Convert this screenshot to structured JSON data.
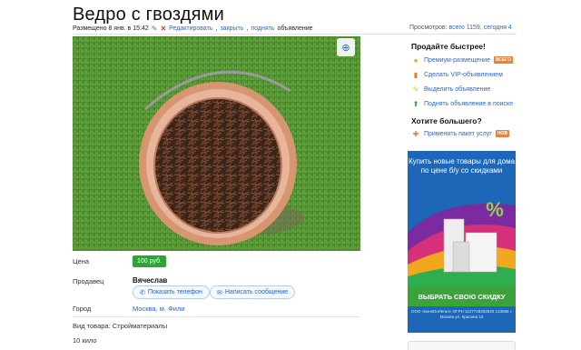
{
  "listing": {
    "title": "Ведро с гвоздями",
    "posted": "Размещено 8 янв. в 15:42",
    "actions": [
      "Редактировать",
      "закрыть",
      "поднять"
    ],
    "actions_suffix": "объявление",
    "views_label": "Просмотров:",
    "views_total": "всего 1159",
    "views_today": "сегодня 4"
  },
  "details": {
    "price_label": "Цена",
    "price": "100 руб.",
    "seller_label": "Продавец",
    "seller_name": "Вячеслав",
    "show_phone": "Показать телефон",
    "write_message": "Написать сообщение",
    "city_label": "Город",
    "city": "Москва, м. Фили",
    "type_line": "Вид товара: Стройматериалы",
    "description": "10 кило"
  },
  "sidebar": {
    "sell_faster": "Продайте быстрее!",
    "services": [
      {
        "label": "Премиум-размещение",
        "badge": "ВСЕГО",
        "icon": "premium-icon"
      },
      {
        "label": "Сделать VIP-объявлением",
        "icon": "vip-icon"
      },
      {
        "label": "Выделить объявление",
        "icon": "highlight-icon"
      },
      {
        "label": "Поднять объявление в поиске",
        "icon": "raise-icon"
      }
    ],
    "want_more": "Хотите большего?",
    "package": {
      "label": "Применить пакет услуг",
      "badge": "НОВ",
      "icon": "package-icon"
    }
  },
  "ad": {
    "headline": "Купить новые товары для дома по цене б/у со скидками",
    "cta": "ВЫБРАТЬ СВОЮ СКИДКУ",
    "footer": "ООО «БэнкОнЛегал» ОГРН 1127746262920 123056 г. Москва ул. Красина 13"
  },
  "colors": {
    "link": "#2a66c9",
    "price_bg": "#2ba533",
    "ad_bg": "#1e66b8",
    "ad_cta": "#3aa43a"
  }
}
